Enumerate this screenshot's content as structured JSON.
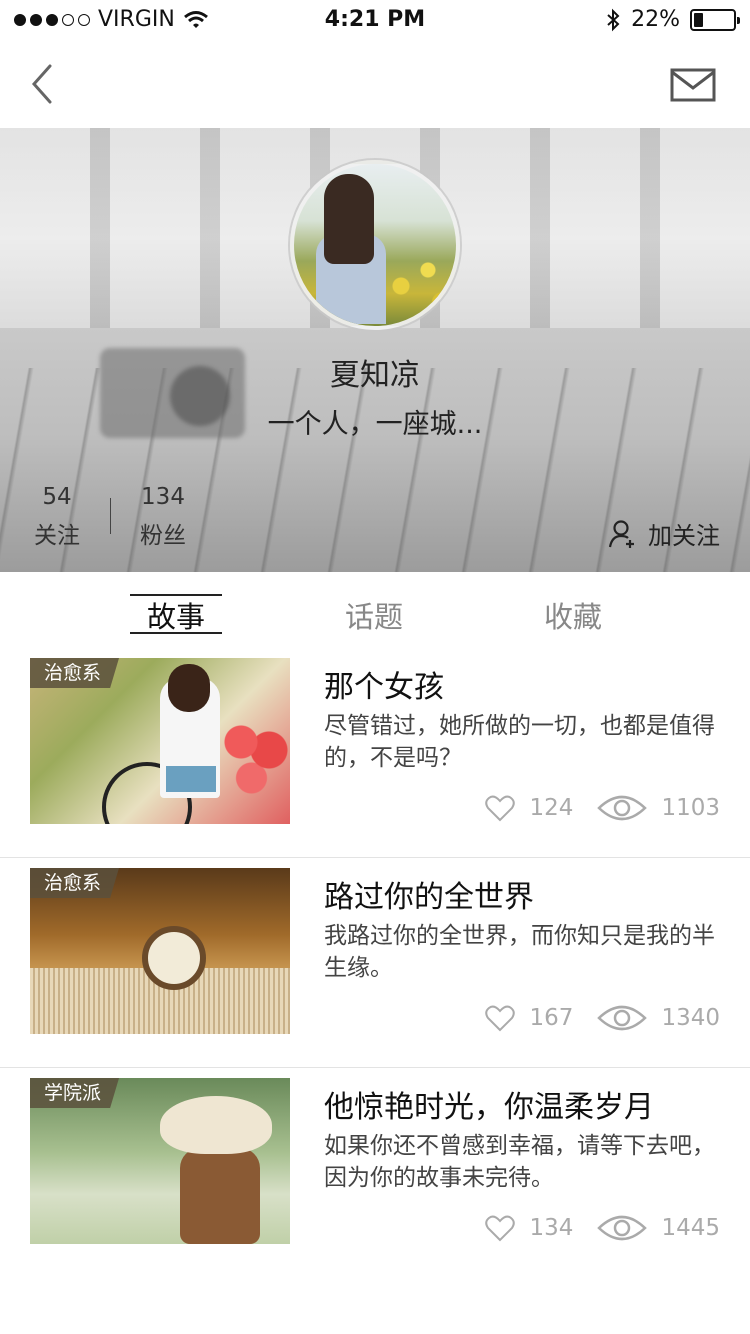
{
  "status": {
    "carrier": "VIRGIN",
    "time": "4:21 PM",
    "battery": "22%",
    "battery_level": 0.22,
    "signal_dots": 5,
    "signal_filled": 3
  },
  "nav": {
    "back_icon": "chevron-left-icon",
    "mail_icon": "mail-icon"
  },
  "profile": {
    "name": "夏知凉",
    "bio": "一个人，一座城...",
    "following_count": "54",
    "following_label": "关注",
    "fans_count": "134",
    "fans_label": "粉丝",
    "follow_button": "加关注"
  },
  "tabs": [
    {
      "label": "故事",
      "active": true
    },
    {
      "label": "话题",
      "active": false
    },
    {
      "label": "收藏",
      "active": false
    }
  ],
  "stories": [
    {
      "tag": "治愈系",
      "title": "那个女孩",
      "desc": "尽管错过，她所做的一切，也都是值得的，不是吗？",
      "likes": "124",
      "views": "1103"
    },
    {
      "tag": "治愈系",
      "title": "路过你的全世界",
      "desc": "我路过你的全世界，而你知只是我的半生缘。",
      "likes": "167",
      "views": "1340"
    },
    {
      "tag": "学院派",
      "title": "他惊艳时光，你温柔岁月",
      "desc": "如果你还不曾感到幸福，请等下去吧，因为你的故事未完待。",
      "likes": "134",
      "views": "1445"
    }
  ],
  "colors": {
    "text_primary": "#111111",
    "text_muted": "#aaaaaa",
    "tag_bg": "#5a503c"
  }
}
